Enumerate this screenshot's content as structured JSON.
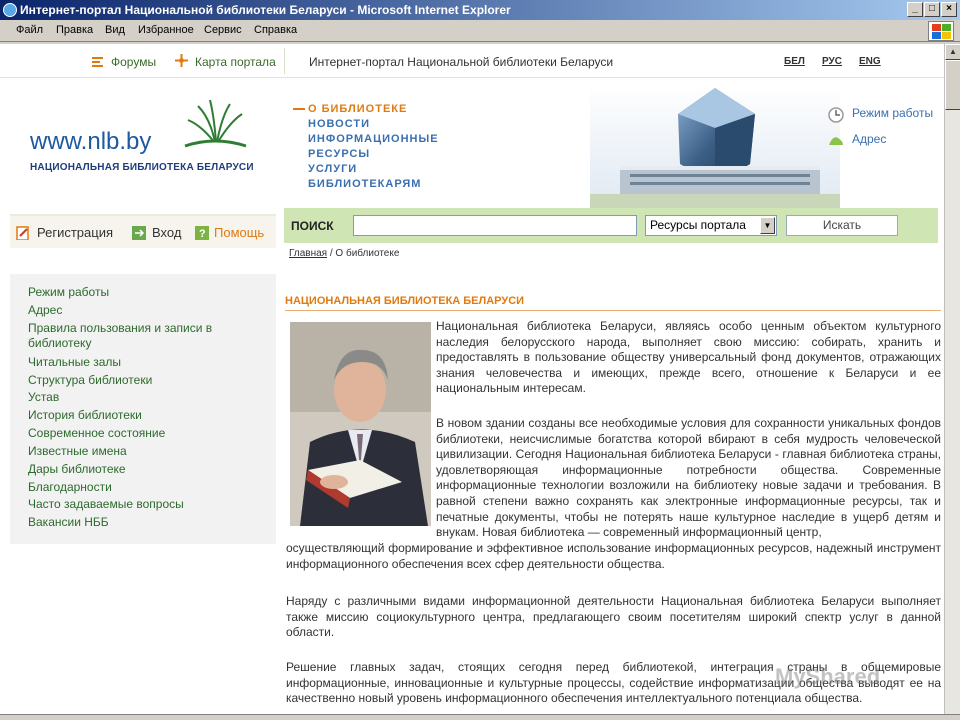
{
  "window": {
    "title": "Интернет-портал Национальной библиотеки Беларуси - Microsoft Internet Explorer",
    "buttons": {
      "minimize": "_",
      "maximize": "□",
      "close": "×"
    }
  },
  "menu": [
    "Файл",
    "Правка",
    "Вид",
    "Избранное",
    "Сервис",
    "Справка"
  ],
  "topstrip": {
    "forums": "Форумы",
    "sitemap": "Карта портала",
    "portal_title": "Интернет-портал Национальной библиотеки Беларуси",
    "languages": [
      "БЕЛ",
      "РУС",
      "ENG"
    ]
  },
  "logo": {
    "url": "www.nlb.by",
    "name": "НАЦИОНАЛЬНАЯ БИБЛИОТЕКА БЕЛАРУСИ"
  },
  "nav": [
    {
      "label": "О БИБЛИОТЕКЕ",
      "active": true
    },
    {
      "label": "НОВОСТИ",
      "active": false
    },
    {
      "label": "ИНФОРМАЦИОННЫЕ РЕСУРСЫ",
      "active": false
    },
    {
      "label": "УСЛУГИ",
      "active": false
    },
    {
      "label": "БИБЛИОТЕКАРЯМ",
      "active": false
    }
  ],
  "right_links": {
    "hours": "Режим работы",
    "address": "Адрес"
  },
  "search": {
    "label": "ПОИСК",
    "input_value": "",
    "scope": "Ресурсы портала",
    "button": "Искать"
  },
  "user": {
    "register": "Регистрация",
    "login": "Вход",
    "help": "Помощь"
  },
  "breadcrumb": {
    "home": "Главная",
    "sep": " / ",
    "current": "О библиотеке"
  },
  "sidebar": [
    "Режим работы",
    "Адрес",
    "Правила пользования и записи в библиотеку",
    "Читальные залы",
    "Структура библиотеки",
    "Устав",
    "История библиотеки",
    "Современное состояние",
    "Известные имена",
    "Дары библиотеке",
    "Благодарности",
    "Часто задаваемые вопросы",
    "Вакансии НББ"
  ],
  "article": {
    "heading": "НАЦИОНАЛЬНАЯ БИБЛИОТЕКА БЕЛАРУСИ",
    "p1": "Национальная библиотека Беларуси, являясь особо ценным объектом культурного наследия белорусского народа, выполняет свою миссию: собирать, хранить и предоставлять в пользование обществу универсальный фонд документов, отражающих знания человечества и имеющих, прежде всего, отношение к Беларуси и ее национальным интересам.",
    "p2a": "В новом здании созданы все необходимые условия для сохранности уникальных фондов библиотеки, неисчислимые богатства которой вбирают в себя мудрость человеческой цивилизации. Сегодня Национальная библиотека Беларуси - главная библиотека страны, удовлетворяющая информационные потребности общества. Современные информационные технологии возложили на библиотеку новые задачи и требования. В равной степени важно сохранять как электронные информационные ресурсы, так и печатные документы, чтобы не потерять наше культурное наследие в ущерб детям и внукам. Новая библиотека — современный информационный центр,",
    "p2b": "осуществляющий формирование и эффективное использование информационных ресурсов, надежный инструмент информационного обеспечения всех сфер деятельности общества.",
    "p3": "Наряду с различными видами информационной деятельности Национальная библиотека Беларуси выполняет также миссию социокультурного центра, предлагающего своим посетителям широкий спектр услуг в данной области.",
    "p4": "Решение главных задач, стоящих сегодня перед библиотекой, интеграция страны в общемировые информационные, инновационные и культурные процессы, содействие информатизации общества выводят ее на качественно новый уровень информационного обеспечения интеллектуального потенциала общества."
  },
  "watermark": "MyShared",
  "colors": {
    "accent_orange": "#e07a10",
    "nav_blue": "#3a6fb0",
    "search_green": "#cfe5b4",
    "link_green": "#2d6a2d"
  }
}
